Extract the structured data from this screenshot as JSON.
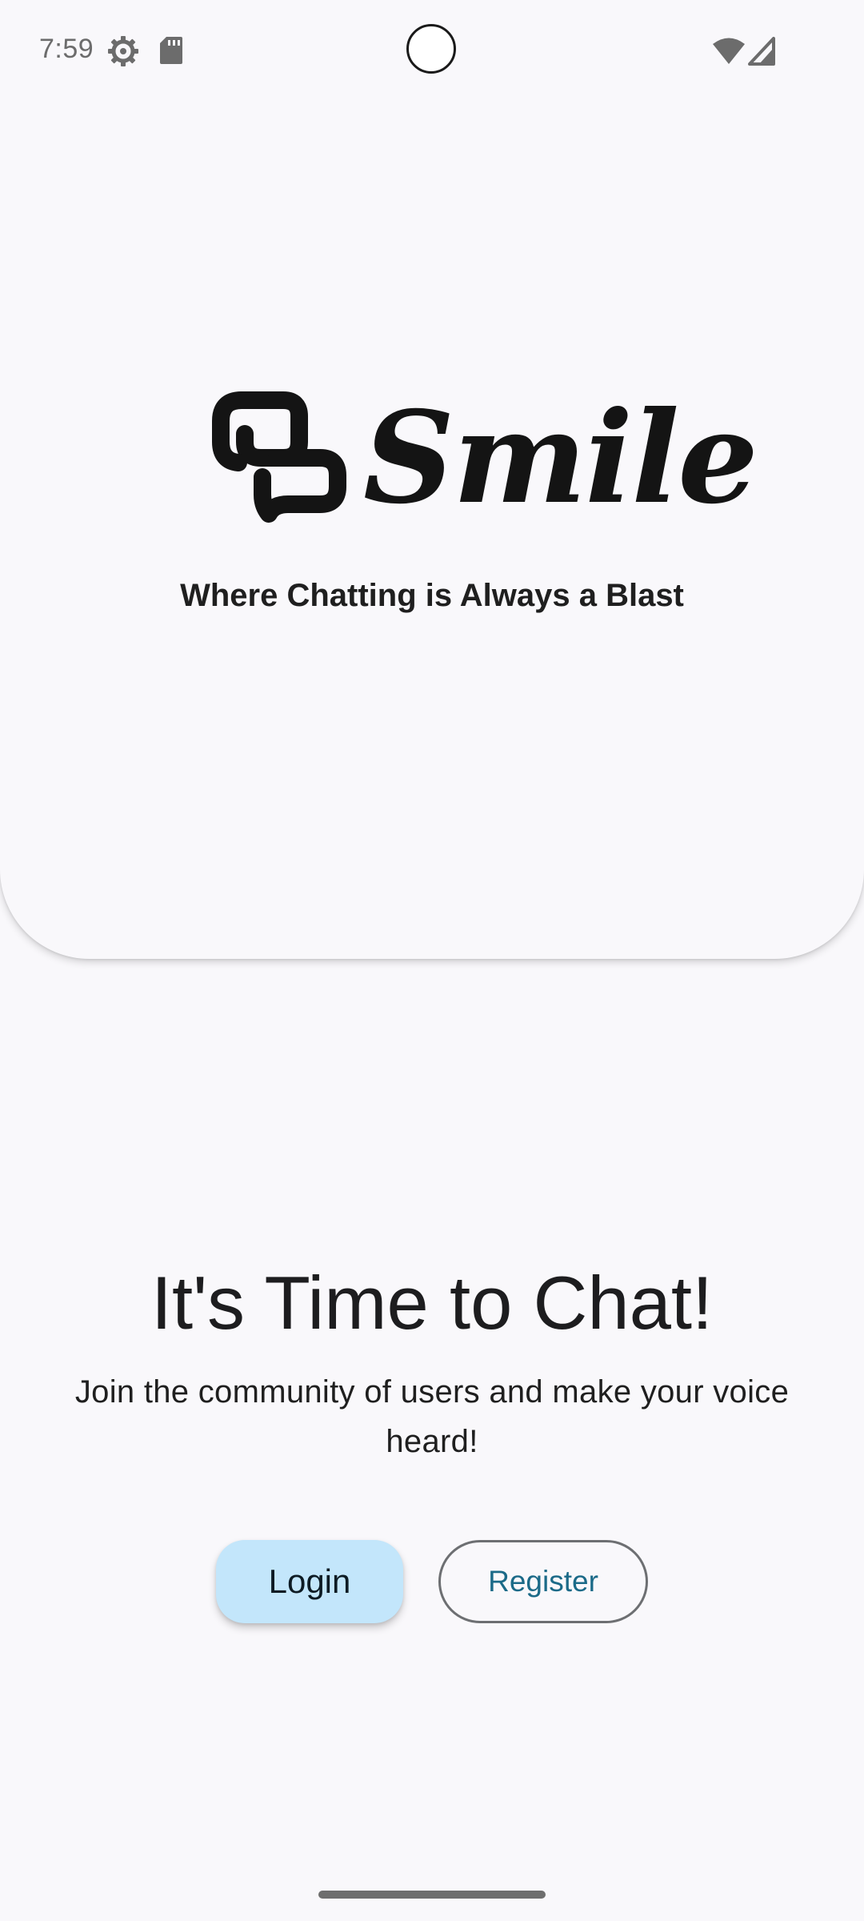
{
  "status_bar": {
    "time": "7:59",
    "icons": [
      "gear-icon",
      "sdcard-icon",
      "wifi-icon",
      "signal-icon"
    ]
  },
  "hero": {
    "logo_text": "Smile",
    "tagline": "Where Chatting is Always a Blast"
  },
  "main": {
    "headline": "It's Time to Chat!",
    "subline": "Join the community of users and make your voice heard!"
  },
  "actions": {
    "login_label": "Login",
    "register_label": "Register"
  },
  "colors": {
    "background": "#f9f8fb",
    "login_fill": "#c3e6fb",
    "register_text": "#1b6a88",
    "logo": "#141414"
  }
}
